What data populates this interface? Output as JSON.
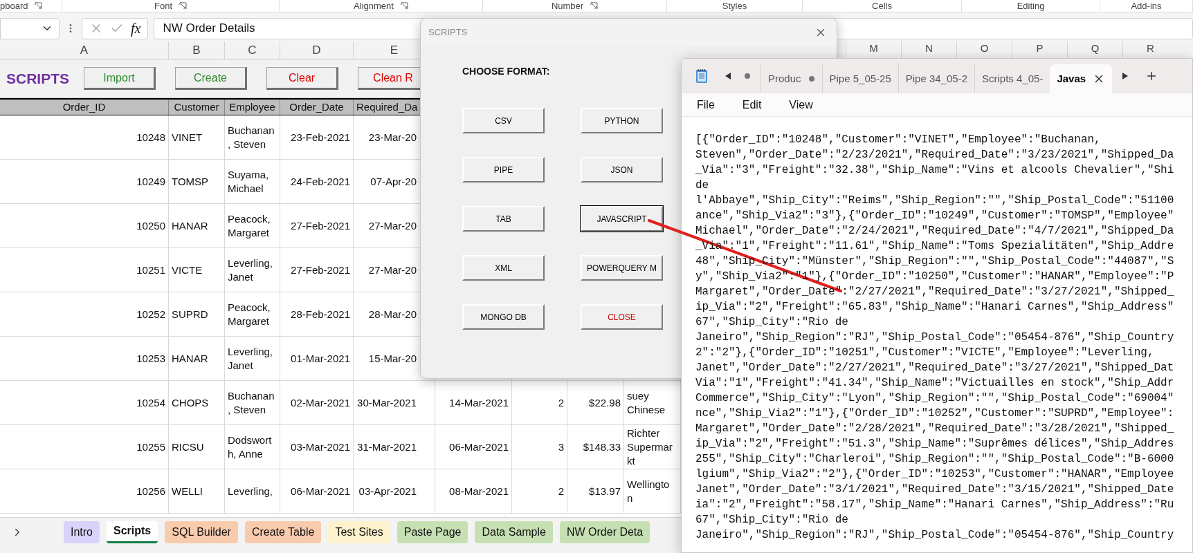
{
  "ribbon": {
    "group_labels": [
      {
        "label": "pboard",
        "launcher": true
      },
      {
        "label": "Font",
        "launcher": true
      },
      {
        "label": "Alignment",
        "launcher": true
      },
      {
        "label": "Number",
        "launcher": true
      },
      {
        "label": "Styles",
        "launcher": false
      },
      {
        "label": "Cells",
        "launcher": false
      },
      {
        "label": "Editing",
        "launcher": false
      },
      {
        "label": "Add-ins",
        "launcher": false
      }
    ]
  },
  "formula_bar": {
    "function_label": "fx",
    "value": "NW Order Details"
  },
  "sheet": {
    "column_headers": [
      "A",
      "B",
      "C",
      "D",
      "E"
    ],
    "column_headers_right": [
      "M",
      "N",
      "O",
      "P",
      "Q",
      "R"
    ],
    "title": "SCRIPTS",
    "buttons": [
      {
        "label": "Import",
        "color": "#2e8b2e"
      },
      {
        "label": "Create",
        "color": "#2e8b2e"
      },
      {
        "label": "Clear",
        "color": "#e00000"
      },
      {
        "label": "Clean R",
        "color": "#e00000"
      }
    ],
    "table": {
      "columns": [
        "Order_ID",
        "Customer",
        "Employee",
        "Order_Date",
        "Required_Da"
      ],
      "rows": [
        {
          "order_id": "10248",
          "customer": "VINET",
          "employee": "Buchanan\n, Steven",
          "order_date": "23-Feb-2021",
          "required_date": "23-Mar-20"
        },
        {
          "order_id": "10249",
          "customer": "TOMSP",
          "employee": "Suyama,\nMichael",
          "order_date": "24-Feb-2021",
          "required_date": "07-Apr-20"
        },
        {
          "order_id": "10250",
          "customer": "HANAR",
          "employee": "Peacock,\nMargaret",
          "order_date": "27-Feb-2021",
          "required_date": "27-Mar-20"
        },
        {
          "order_id": "10251",
          "customer": "VICTE",
          "employee": "Leverling,\nJanet",
          "order_date": "27-Feb-2021",
          "required_date": "27-Mar-20"
        },
        {
          "order_id": "10252",
          "customer": "SUPRD",
          "employee": "Peacock,\nMargaret",
          "order_date": "28-Feb-2021",
          "required_date": "28-Mar-20"
        },
        {
          "order_id": "10253",
          "customer": "HANAR",
          "employee": "Leverling,\nJanet",
          "order_date": "01-Mar-2021",
          "required_date": "15-Mar-20"
        },
        {
          "order_id": "10254",
          "customer": "CHOPS",
          "employee": "Buchanan\n, Steven",
          "order_date": "02-Mar-2021",
          "required_date": "30-Mar-2021",
          "column_f": "14-Mar-2021",
          "column_g": "2",
          "column_h": "$22.98",
          "column_i": "suey\nChinese"
        },
        {
          "order_id": "10255",
          "customer": "RICSU",
          "employee": "Dodswort\nh, Anne",
          "order_date": "03-Mar-2021",
          "required_date": "31-Mar-2021",
          "column_f": "06-Mar-2021",
          "column_g": "3",
          "column_h": "$148.33",
          "column_i": "Richter\nSupermar\nkt"
        },
        {
          "order_id": "10256",
          "customer": "WELLI",
          "employee": "Leverling,",
          "order_date": "06-Mar-2021",
          "required_date": "03-Apr-2021",
          "column_f": "08-Mar-2021",
          "column_g": "2",
          "column_h": "$13.97",
          "column_i": "Wellingto\nn"
        }
      ]
    }
  },
  "sheet_tabs": [
    {
      "label": "Intro",
      "color": "#d9d3fb",
      "selected": false
    },
    {
      "label": "Scripts",
      "selected": true
    },
    {
      "label": "SQL Builder",
      "color": "#f8cbad",
      "selected": false
    },
    {
      "label": "Create Table",
      "color": "#f8cbad",
      "selected": false
    },
    {
      "label": "Test Sites",
      "color": "#fff2cc",
      "selected": false
    },
    {
      "label": "Paste Page",
      "color": "#c6e0b4",
      "selected": false
    },
    {
      "label": "Data Sample",
      "color": "#c6e0b4",
      "selected": false
    },
    {
      "label": "NW Order Deta",
      "color": "#c6e0b4",
      "selected": false
    }
  ],
  "dialog": {
    "title": "SCRIPTS",
    "heading": "CHOOSE FORMAT:",
    "buttons": [
      {
        "label": "CSV",
        "kind": "format",
        "focused": false
      },
      {
        "label": "PYTHON",
        "kind": "format",
        "focused": false
      },
      {
        "label": "PIPE",
        "kind": "format",
        "focused": false
      },
      {
        "label": "JSON",
        "kind": "format",
        "focused": false
      },
      {
        "label": "TAB",
        "kind": "format",
        "focused": false
      },
      {
        "label": "JAVASCRIPT",
        "kind": "format",
        "focused": true
      },
      {
        "label": "XML",
        "kind": "format",
        "focused": false
      },
      {
        "label": "POWERQUERY M",
        "kind": "format",
        "focused": false
      },
      {
        "label": "MONGO DB",
        "kind": "format",
        "focused": false
      },
      {
        "label": "CLOSE",
        "kind": "close",
        "focused": false
      }
    ]
  },
  "notepad": {
    "tabs": [
      {
        "label": "Produc",
        "modified": true,
        "selected": false
      },
      {
        "label": "Pipe 5_05-25",
        "modified": false,
        "selected": false
      },
      {
        "label": "Pipe 34_05-2",
        "modified": false,
        "selected": false
      },
      {
        "label": "Scripts 4_05-",
        "modified": false,
        "selected": false
      },
      {
        "label": "Javas",
        "modified": false,
        "selected": true
      }
    ],
    "menu": [
      "File",
      "Edit",
      "View"
    ],
    "lines": [
      "[{\"Order_ID\":\"10248\",\"Customer\":\"VINET\",\"Employee\":\"Buchanan,",
      "Steven\",\"Order_Date\":\"2/23/2021\",\"Required_Date\":\"3/23/2021\",\"Shipped_Da",
      "_Via\":\"3\",\"Freight\":\"32.38\",\"Ship_Name\":\"Vins et alcools Chevalier\",\"Shi",
      "de",
      "l'Abbaye\",\"Ship_City\":\"Reims\",\"Ship_Region\":\"\",\"Ship_Postal_Code\":\"51100",
      "ance\",\"Ship_Via2\":\"3\"},{\"Order_ID\":\"10249\",\"Customer\":\"TOMSP\",\"Employee\"",
      "Michael\",\"Order_Date\":\"2/24/2021\",\"Required_Date\":\"4/7/2021\",\"Shipped_Da",
      "_Via\":\"1\",\"Freight\":\"11.61\",\"Ship_Name\":\"Toms Spezialitäten\",\"Ship_Addre",
      "48\",\"Ship_City\":\"Münster\",\"Ship_Region\":\"\",\"Ship_Postal_Code\":\"44087\",\"S",
      "y\",\"Ship_Via2\":\"1\"},{\"Order_ID\":\"10250\",\"Customer\":\"HANAR\",\"Employee\":\"P",
      "Margaret\",\"Order_Date\":\"2/27/2021\",\"Required_Date\":\"3/27/2021\",\"Shipped_",
      "ip_Via\":\"2\",\"Freight\":\"65.83\",\"Ship_Name\":\"Hanari Carnes\",\"Ship_Address\"",
      "67\",\"Ship_City\":\"Rio de",
      "Janeiro\",\"Ship_Region\":\"RJ\",\"Ship_Postal_Code\":\"05454-876\",\"Ship_Country",
      "2\":\"2\"},{\"Order_ID\":\"10251\",\"Customer\":\"VICTE\",\"Employee\":\"Leverling,",
      "Janet\",\"Order_Date\":\"2/27/2021\",\"Required_Date\":\"3/27/2021\",\"Shipped_Dat",
      "Via\":\"1\",\"Freight\":\"41.34\",\"Ship_Name\":\"Victuailles en stock\",\"Ship_Addr",
      "Commerce\",\"Ship_City\":\"Lyon\",\"Ship_Region\":\"\",\"Ship_Postal_Code\":\"69004\"",
      "nce\",\"Ship_Via2\":\"1\"},{\"Order_ID\":\"10252\",\"Customer\":\"SUPRD\",\"Employee\":",
      "Margaret\",\"Order_Date\":\"2/28/2021\",\"Required_Date\":\"3/28/2021\",\"Shipped_",
      "ip_Via\":\"2\",\"Freight\":\"51.3\",\"Ship_Name\":\"Suprêmes délices\",\"Ship_Addres",
      "255\",\"Ship_City\":\"Charleroi\",\"Ship_Region\":\"\",\"Ship_Postal_Code\":\"B-6000",
      "lgium\",\"Ship_Via2\":\"2\"},{\"Order_ID\":\"10253\",\"Customer\":\"HANAR\",\"Employee",
      "Janet\",\"Order_Date\":\"3/1/2021\",\"Required_Date\":\"3/15/2021\",\"Shipped_Date",
      "ia\":\"2\",\"Freight\":\"58.17\",\"Ship_Name\":\"Hanari Carnes\",\"Ship_Address\":\"Ru",
      "67\",\"Ship_City\":\"Rio de",
      "Janeiro\",\"Ship_Region\":\"RJ\",\"Ship_Postal_Code\":\"05454-876\",\"Ship_Country"
    ]
  }
}
